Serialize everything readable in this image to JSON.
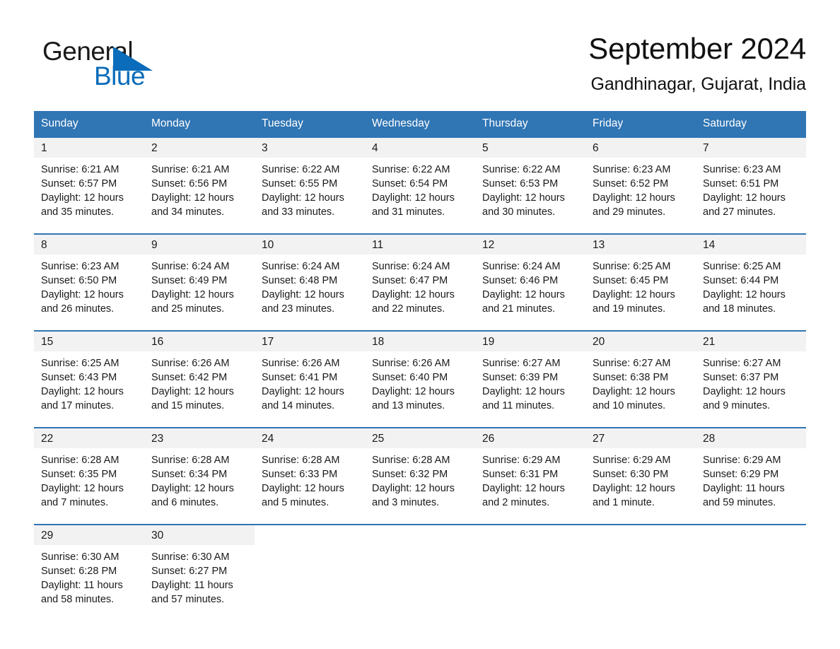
{
  "brand": {
    "name_part1": "General",
    "name_part2": "Blue",
    "triangle_icon": "triangle-icon",
    "accent_color": "#0a6cba"
  },
  "header": {
    "title": "September 2024",
    "location": "Gandhinagar, Gujarat, India"
  },
  "theme": {
    "header_bg": "#3075b4",
    "daynum_bg": "#f2f2f2",
    "text": "#1a1a1a"
  },
  "weekdays": [
    "Sunday",
    "Monday",
    "Tuesday",
    "Wednesday",
    "Thursday",
    "Friday",
    "Saturday"
  ],
  "labels": {
    "sunrise": "Sunrise:",
    "sunset": "Sunset:",
    "daylight": "Daylight:"
  },
  "weeks": [
    [
      {
        "day": "1",
        "sunrise": "Sunrise: 6:21 AM",
        "sunset": "Sunset: 6:57 PM",
        "daylight_l1": "Daylight: 12 hours",
        "daylight_l2": "and 35 minutes."
      },
      {
        "day": "2",
        "sunrise": "Sunrise: 6:21 AM",
        "sunset": "Sunset: 6:56 PM",
        "daylight_l1": "Daylight: 12 hours",
        "daylight_l2": "and 34 minutes."
      },
      {
        "day": "3",
        "sunrise": "Sunrise: 6:22 AM",
        "sunset": "Sunset: 6:55 PM",
        "daylight_l1": "Daylight: 12 hours",
        "daylight_l2": "and 33 minutes."
      },
      {
        "day": "4",
        "sunrise": "Sunrise: 6:22 AM",
        "sunset": "Sunset: 6:54 PM",
        "daylight_l1": "Daylight: 12 hours",
        "daylight_l2": "and 31 minutes."
      },
      {
        "day": "5",
        "sunrise": "Sunrise: 6:22 AM",
        "sunset": "Sunset: 6:53 PM",
        "daylight_l1": "Daylight: 12 hours",
        "daylight_l2": "and 30 minutes."
      },
      {
        "day": "6",
        "sunrise": "Sunrise: 6:23 AM",
        "sunset": "Sunset: 6:52 PM",
        "daylight_l1": "Daylight: 12 hours",
        "daylight_l2": "and 29 minutes."
      },
      {
        "day": "7",
        "sunrise": "Sunrise: 6:23 AM",
        "sunset": "Sunset: 6:51 PM",
        "daylight_l1": "Daylight: 12 hours",
        "daylight_l2": "and 27 minutes."
      }
    ],
    [
      {
        "day": "8",
        "sunrise": "Sunrise: 6:23 AM",
        "sunset": "Sunset: 6:50 PM",
        "daylight_l1": "Daylight: 12 hours",
        "daylight_l2": "and 26 minutes."
      },
      {
        "day": "9",
        "sunrise": "Sunrise: 6:24 AM",
        "sunset": "Sunset: 6:49 PM",
        "daylight_l1": "Daylight: 12 hours",
        "daylight_l2": "and 25 minutes."
      },
      {
        "day": "10",
        "sunrise": "Sunrise: 6:24 AM",
        "sunset": "Sunset: 6:48 PM",
        "daylight_l1": "Daylight: 12 hours",
        "daylight_l2": "and 23 minutes."
      },
      {
        "day": "11",
        "sunrise": "Sunrise: 6:24 AM",
        "sunset": "Sunset: 6:47 PM",
        "daylight_l1": "Daylight: 12 hours",
        "daylight_l2": "and 22 minutes."
      },
      {
        "day": "12",
        "sunrise": "Sunrise: 6:24 AM",
        "sunset": "Sunset: 6:46 PM",
        "daylight_l1": "Daylight: 12 hours",
        "daylight_l2": "and 21 minutes."
      },
      {
        "day": "13",
        "sunrise": "Sunrise: 6:25 AM",
        "sunset": "Sunset: 6:45 PM",
        "daylight_l1": "Daylight: 12 hours",
        "daylight_l2": "and 19 minutes."
      },
      {
        "day": "14",
        "sunrise": "Sunrise: 6:25 AM",
        "sunset": "Sunset: 6:44 PM",
        "daylight_l1": "Daylight: 12 hours",
        "daylight_l2": "and 18 minutes."
      }
    ],
    [
      {
        "day": "15",
        "sunrise": "Sunrise: 6:25 AM",
        "sunset": "Sunset: 6:43 PM",
        "daylight_l1": "Daylight: 12 hours",
        "daylight_l2": "and 17 minutes."
      },
      {
        "day": "16",
        "sunrise": "Sunrise: 6:26 AM",
        "sunset": "Sunset: 6:42 PM",
        "daylight_l1": "Daylight: 12 hours",
        "daylight_l2": "and 15 minutes."
      },
      {
        "day": "17",
        "sunrise": "Sunrise: 6:26 AM",
        "sunset": "Sunset: 6:41 PM",
        "daylight_l1": "Daylight: 12 hours",
        "daylight_l2": "and 14 minutes."
      },
      {
        "day": "18",
        "sunrise": "Sunrise: 6:26 AM",
        "sunset": "Sunset: 6:40 PM",
        "daylight_l1": "Daylight: 12 hours",
        "daylight_l2": "and 13 minutes."
      },
      {
        "day": "19",
        "sunrise": "Sunrise: 6:27 AM",
        "sunset": "Sunset: 6:39 PM",
        "daylight_l1": "Daylight: 12 hours",
        "daylight_l2": "and 11 minutes."
      },
      {
        "day": "20",
        "sunrise": "Sunrise: 6:27 AM",
        "sunset": "Sunset: 6:38 PM",
        "daylight_l1": "Daylight: 12 hours",
        "daylight_l2": "and 10 minutes."
      },
      {
        "day": "21",
        "sunrise": "Sunrise: 6:27 AM",
        "sunset": "Sunset: 6:37 PM",
        "daylight_l1": "Daylight: 12 hours",
        "daylight_l2": "and 9 minutes."
      }
    ],
    [
      {
        "day": "22",
        "sunrise": "Sunrise: 6:28 AM",
        "sunset": "Sunset: 6:35 PM",
        "daylight_l1": "Daylight: 12 hours",
        "daylight_l2": "and 7 minutes."
      },
      {
        "day": "23",
        "sunrise": "Sunrise: 6:28 AM",
        "sunset": "Sunset: 6:34 PM",
        "daylight_l1": "Daylight: 12 hours",
        "daylight_l2": "and 6 minutes."
      },
      {
        "day": "24",
        "sunrise": "Sunrise: 6:28 AM",
        "sunset": "Sunset: 6:33 PM",
        "daylight_l1": "Daylight: 12 hours",
        "daylight_l2": "and 5 minutes."
      },
      {
        "day": "25",
        "sunrise": "Sunrise: 6:28 AM",
        "sunset": "Sunset: 6:32 PM",
        "daylight_l1": "Daylight: 12 hours",
        "daylight_l2": "and 3 minutes."
      },
      {
        "day": "26",
        "sunrise": "Sunrise: 6:29 AM",
        "sunset": "Sunset: 6:31 PM",
        "daylight_l1": "Daylight: 12 hours",
        "daylight_l2": "and 2 minutes."
      },
      {
        "day": "27",
        "sunrise": "Sunrise: 6:29 AM",
        "sunset": "Sunset: 6:30 PM",
        "daylight_l1": "Daylight: 12 hours",
        "daylight_l2": "and 1 minute."
      },
      {
        "day": "28",
        "sunrise": "Sunrise: 6:29 AM",
        "sunset": "Sunset: 6:29 PM",
        "daylight_l1": "Daylight: 11 hours",
        "daylight_l2": "and 59 minutes."
      }
    ],
    [
      {
        "day": "29",
        "sunrise": "Sunrise: 6:30 AM",
        "sunset": "Sunset: 6:28 PM",
        "daylight_l1": "Daylight: 11 hours",
        "daylight_l2": "and 58 minutes."
      },
      {
        "day": "30",
        "sunrise": "Sunrise: 6:30 AM",
        "sunset": "Sunset: 6:27 PM",
        "daylight_l1": "Daylight: 11 hours",
        "daylight_l2": "and 57 minutes."
      },
      {
        "day": "",
        "sunrise": "",
        "sunset": "",
        "daylight_l1": "",
        "daylight_l2": ""
      },
      {
        "day": "",
        "sunrise": "",
        "sunset": "",
        "daylight_l1": "",
        "daylight_l2": ""
      },
      {
        "day": "",
        "sunrise": "",
        "sunset": "",
        "daylight_l1": "",
        "daylight_l2": ""
      },
      {
        "day": "",
        "sunrise": "",
        "sunset": "",
        "daylight_l1": "",
        "daylight_l2": ""
      },
      {
        "day": "",
        "sunrise": "",
        "sunset": "",
        "daylight_l1": "",
        "daylight_l2": ""
      }
    ]
  ]
}
